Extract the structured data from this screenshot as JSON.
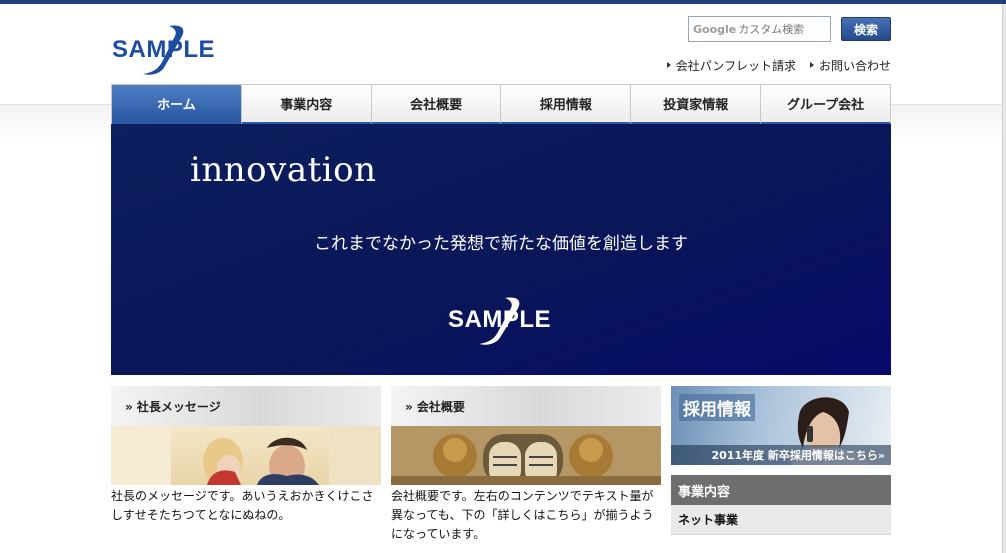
{
  "header": {
    "logo_text": "SAMPLE",
    "search": {
      "placeholder_brand": "Google",
      "placeholder": "カスタム検索",
      "button_label": "検索"
    },
    "util_links": [
      "会社パンフレット請求",
      "お問い合わせ"
    ]
  },
  "nav": {
    "items": [
      {
        "label": "ホーム",
        "active": true
      },
      {
        "label": "事業内容",
        "active": false
      },
      {
        "label": "会社概要",
        "active": false
      },
      {
        "label": "採用情報",
        "active": false
      },
      {
        "label": "投資家情報",
        "active": false
      },
      {
        "label": "グループ会社",
        "active": false
      }
    ]
  },
  "hero": {
    "title": "innovation",
    "subtitle": "これまでなかった発想で新たな価値を創造します",
    "logo_text": "SAMPLE"
  },
  "panels": [
    {
      "heading": "» 社長メッセージ",
      "text": "社長のメッセージです。あいうえおかきくけこさしすせそたちつてとなにぬねの。"
    },
    {
      "heading": "» 会社概要",
      "text": "会社概要です。左右のコンテンツでテキスト量が異なっても、下の「詳しくはこちら」が揃うようになっています。"
    }
  ],
  "sidebar": {
    "recruit_banner": {
      "title": "採用情報",
      "caption": "2011年度 新卒採用情報はこちら»"
    },
    "section_heading": "事業内容",
    "items": [
      "ネット事業"
    ]
  },
  "colors": {
    "brand": "#1d4d9e",
    "nav_active": "#2a579f",
    "hero_bg": "#0a1658"
  }
}
